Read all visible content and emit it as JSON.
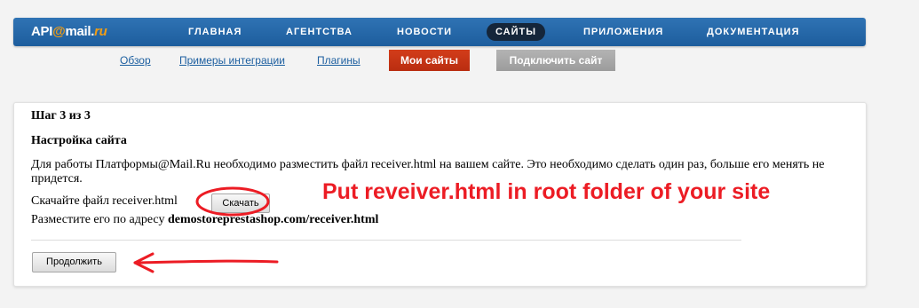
{
  "logo": {
    "api": "API",
    "at": "@",
    "mail": "mail",
    "dot": ".",
    "ru": "ru"
  },
  "nav": [
    {
      "label": "ГЛАВНАЯ"
    },
    {
      "label": "АГЕНТСТВА"
    },
    {
      "label": "НОВОСТИ"
    },
    {
      "label": "САЙТЫ",
      "active": true
    },
    {
      "label": "ПРИЛОЖЕНИЯ"
    },
    {
      "label": "ДОКУМЕНТАЦИЯ"
    }
  ],
  "subnav": {
    "overview": "Обзор",
    "examples": "Примеры интеграции",
    "plugins": "Плагины",
    "my_sites": "Мои сайты",
    "connect_site": "Подключить сайт"
  },
  "panel": {
    "step": "Шаг 3 из 3",
    "heading": "Настройка сайта",
    "description": "Для работы Платформы@Mail.Ru необходимо разместить файл receiver.html на вашем сайте. Это необходимо сделать один раз, больше его менять не придется.",
    "download_text": "Скачайте файл receiver.html",
    "download_button": "Скачать",
    "place_text": "Разместите его по адресу",
    "place_url": "demostoreprestashop.com/receiver.html",
    "continue_button": "Продолжить"
  },
  "annotation": {
    "text": "Put reveiver.html in root folder of your site",
    "color": "#ec1c24"
  },
  "colors": {
    "topbar": "#2a6aab",
    "active_pill": "#15263a",
    "link": "#1b5e9f",
    "red_button": "#c8341a",
    "grey_button": "#a6a6a6"
  }
}
